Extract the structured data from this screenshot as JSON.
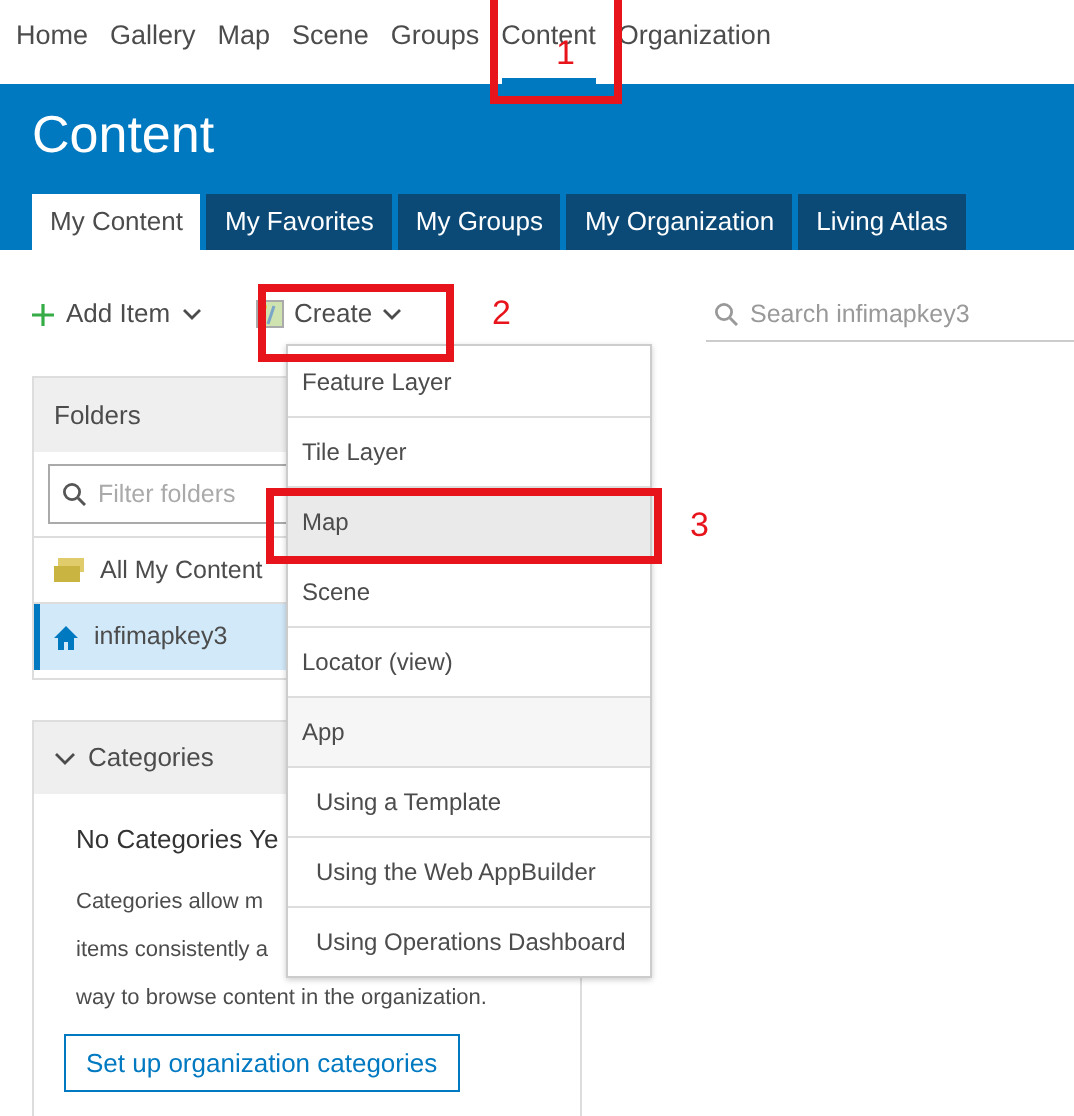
{
  "top_nav": [
    {
      "label": "Home",
      "selected": false
    },
    {
      "label": "Gallery",
      "selected": false
    },
    {
      "label": "Map",
      "selected": false
    },
    {
      "label": "Scene",
      "selected": false
    },
    {
      "label": "Groups",
      "selected": false
    },
    {
      "label": "Content",
      "selected": true
    },
    {
      "label": "Organization",
      "selected": false
    }
  ],
  "banner": {
    "title": "Content"
  },
  "tabs": [
    {
      "label": "My Content",
      "selected": true
    },
    {
      "label": "My Favorites",
      "selected": false
    },
    {
      "label": "My Groups",
      "selected": false
    },
    {
      "label": "My Organization",
      "selected": false
    },
    {
      "label": "Living Atlas",
      "selected": false
    }
  ],
  "toolbar": {
    "add_item": "Add Item",
    "create": "Create"
  },
  "search": {
    "placeholder": "Search infimapkey3"
  },
  "folders": {
    "title": "Folders",
    "filter_placeholder": "Filter folders",
    "items": [
      {
        "label": "All My Content",
        "kind": "all",
        "selected": false
      },
      {
        "label": "infimapkey3",
        "kind": "home",
        "selected": true
      }
    ]
  },
  "categories": {
    "title": "Categories",
    "expanded": true,
    "heading": "No Categories Ye",
    "description_lines": [
      "Categories allow m",
      "items consistently a",
      "way to browse content in the organization."
    ],
    "button": "Set up organization categories"
  },
  "create_menu": {
    "items": [
      {
        "label": "Feature Layer",
        "kind": "item",
        "selected": false
      },
      {
        "label": "Tile Layer",
        "kind": "item",
        "selected": false
      },
      {
        "label": "Map",
        "kind": "item",
        "selected": true
      },
      {
        "label": "Scene",
        "kind": "item",
        "selected": false
      },
      {
        "label": "Locator (view)",
        "kind": "item",
        "selected": false
      },
      {
        "label": "App",
        "kind": "header",
        "selected": false
      },
      {
        "label": "Using a Template",
        "kind": "subitem",
        "selected": false
      },
      {
        "label": "Using the Web AppBuilder",
        "kind": "subitem",
        "selected": false
      },
      {
        "label": "Using Operations Dashboard",
        "kind": "subitem",
        "selected": false
      }
    ]
  },
  "annotations": [
    {
      "label": "1"
    },
    {
      "label": "2"
    },
    {
      "label": "3"
    }
  ]
}
